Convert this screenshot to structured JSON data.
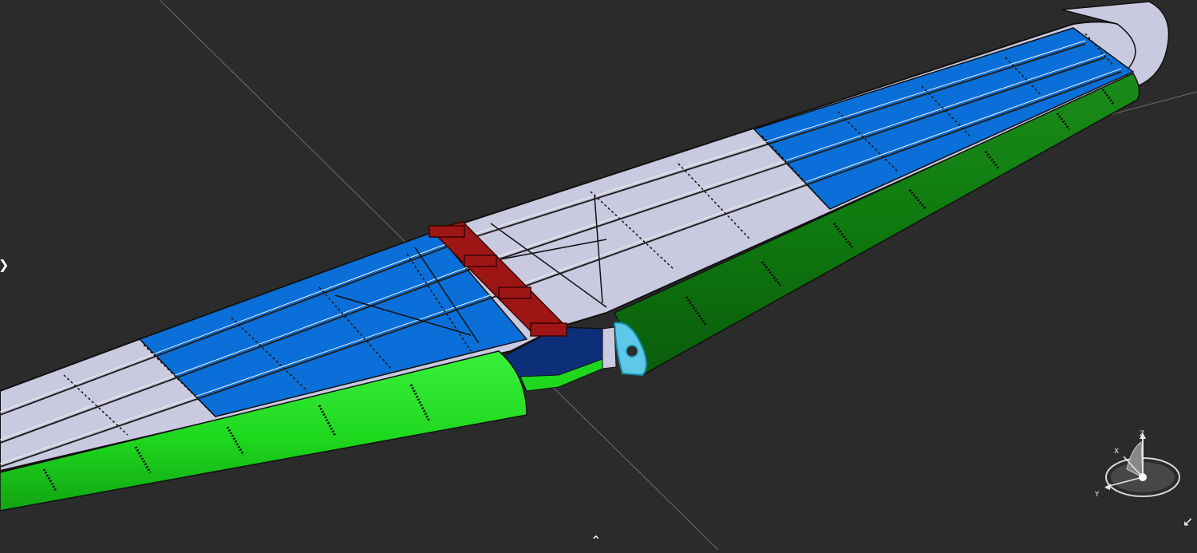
{
  "viewport": {
    "background": "#2b2b2b",
    "colors": {
      "upper_skin": "#c9c9e0",
      "blue_skin": "#0a6fd8",
      "aileron_light": "#1ed81e",
      "aileron_dark": "#0d730d",
      "root_rib": "#0d2f7a",
      "fitting_red": "#9e1515",
      "selected_fitting": "#5ec8e8",
      "outline": "#111111"
    },
    "icons": [
      "chevron-right-icon",
      "chevron-up-icon",
      "diagonal-arrow-icon"
    ]
  },
  "compass": {
    "name": "orientation-triad",
    "axes": {
      "x": "X",
      "y": "Y",
      "z": "Z"
    }
  }
}
